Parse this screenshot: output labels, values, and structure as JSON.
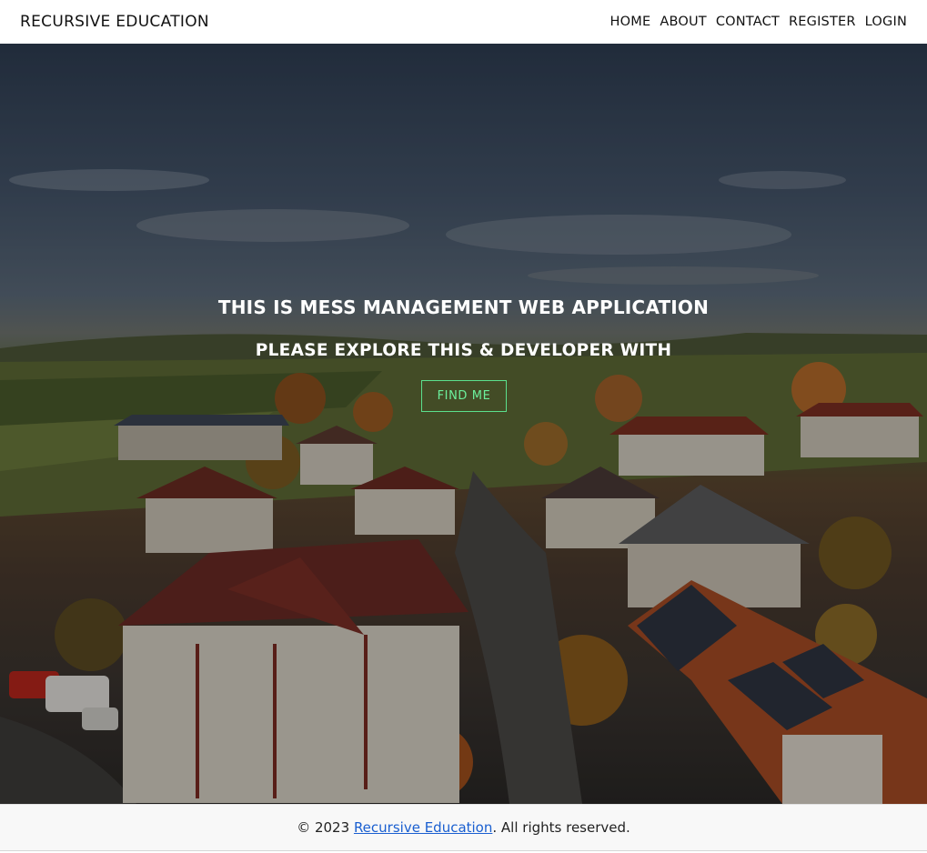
{
  "navbar": {
    "brand": "RECURSIVE EDUCATION",
    "links": [
      {
        "label": "HOME"
      },
      {
        "label": "ABOUT"
      },
      {
        "label": "CONTACT"
      },
      {
        "label": "REGISTER"
      },
      {
        "label": "LOGIN"
      }
    ]
  },
  "hero": {
    "title": "THIS IS MESS MANAGEMENT WEB APPLICATION",
    "subtitle": "PLEASE EXPLORE THIS & DEVELOPER WITH",
    "button_label": "FIND ME",
    "accent_color": "#5be08d"
  },
  "footer": {
    "prefix": "© 2023 ",
    "link_text": "Recursive Education",
    "suffix": ". All rights reserved."
  }
}
